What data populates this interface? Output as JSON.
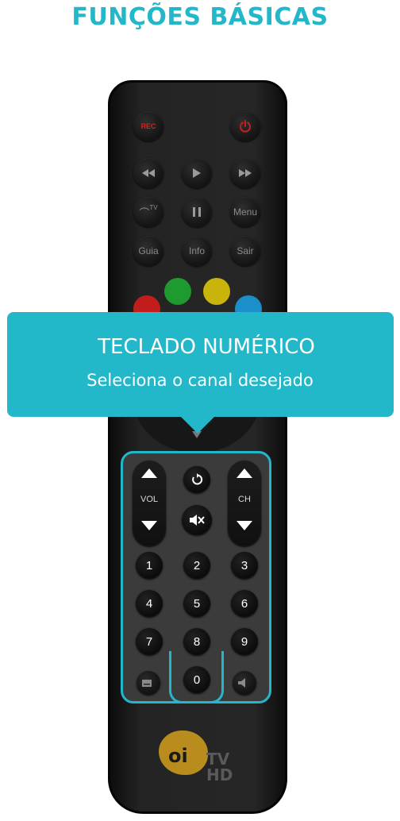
{
  "page": {
    "title": "FUNÇÕES BÁSICAS"
  },
  "tooltip": {
    "title": "TECLADO NUMÉRICO",
    "subtitle": "Seleciona o canal desejado"
  },
  "remote": {
    "top_buttons": {
      "rec_label": "REC",
      "power_icon": "power-icon"
    },
    "playback": {
      "rewind_icon": "rewind-icon",
      "play_icon": "play-icon",
      "forward_icon": "fast-forward-icon"
    },
    "row3": {
      "tv_label": "TV",
      "pause_icon": "pause-icon",
      "menu_label": "Menu"
    },
    "row4": {
      "guide_label": "Guia",
      "info_label": "Info",
      "exit_label": "Sair"
    },
    "color_buttons": [
      "#1e9b2e",
      "#c9b40c",
      "#c21d1d",
      "#1a8fc9"
    ],
    "volume_label": "VOL",
    "channel_label": "CH",
    "back_icon": "return-icon",
    "mute_icon": "mute-icon",
    "keys": [
      "1",
      "2",
      "3",
      "4",
      "5",
      "6",
      "7",
      "8",
      "9",
      "0"
    ],
    "subtitle_icon": "subtitle-icon",
    "audio_icon": "audio-icon",
    "logo": {
      "brand": "oi",
      "line1": "TV",
      "line2": "HD"
    }
  },
  "colors": {
    "accent": "#22b8c9",
    "rec": "#d42121",
    "power": "#c42020"
  }
}
